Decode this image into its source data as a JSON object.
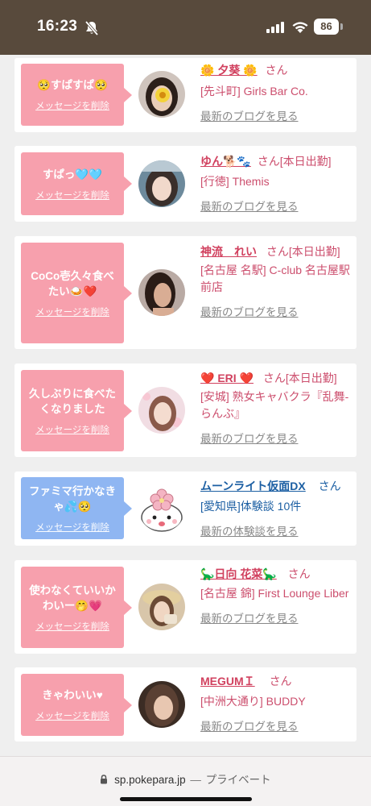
{
  "status_bar": {
    "time": "16:23",
    "battery": "86",
    "icons": [
      "bell-slash-icon",
      "signal-icon",
      "wifi-icon",
      "battery-icon"
    ]
  },
  "colors": {
    "status_bg": "#584a3c",
    "bubble_pink": "#f7a0ad",
    "bubble_blue": "#8fb6f2",
    "name_pink": "#d1415f",
    "name_blue": "#1c5fa3"
  },
  "messages": [
    {
      "text": "🥺すぱすぱ🥺",
      "delete_label": "メッセージを削除",
      "name": "🌼 夕葵 🌼",
      "san": "さん",
      "shop": "[先斗町] Girls Bar Co.",
      "link": "最新のブログを見る"
    },
    {
      "text": "すぱっ🩵🩵",
      "delete_label": "メッセージを削除",
      "name": "ゆん🐕🐾",
      "san": "さん[本日出勤]",
      "shop": "[行徳] Themis",
      "link": "最新のブログを見る"
    },
    {
      "text": "CoCo壱久々食べたい🍛❤️",
      "delete_label": "メッセージを削除",
      "name": "神流　れい",
      "san": "さん[本日出勤]",
      "shop": "[名古屋 名駅] C-club 名古屋駅前店",
      "link": "最新のブログを見る"
    },
    {
      "text": "久しぶりに食べたくなりました",
      "delete_label": "メッセージを削除",
      "name": "❤️ ERI ❤️",
      "san": "さん[本日出勤]",
      "shop": "[安城] 熟女キャバクラ『乱舞-らんぶ』",
      "link": "最新のブログを見る"
    },
    {
      "text": "ファミマ行かなきゃ💦🥺",
      "delete_label": "メッセージを削除",
      "name": "ムーンライト仮面DX",
      "san": "さん",
      "shop": "[愛知県]体験談 10件",
      "link": "最新の体験談を見る"
    },
    {
      "text": "使わなくていいかわいー🤭💗",
      "delete_label": "メッセージを削除",
      "name": "🦕日向 花菜🦕",
      "san": "さん",
      "shop": "[名古屋 錦] First Lounge Liber",
      "link": "最新のブログを見る"
    },
    {
      "text": "きゃわいい♥",
      "delete_label": "メッセージを削除",
      "name": "MEGUMＩ",
      "san": "さん",
      "shop": "[中洲大通り] BUDDY",
      "link": "最新のブログを見る"
    }
  ],
  "browser": {
    "url": "sp.pokepara.jp",
    "separator": "—",
    "mode": "プライベート"
  }
}
